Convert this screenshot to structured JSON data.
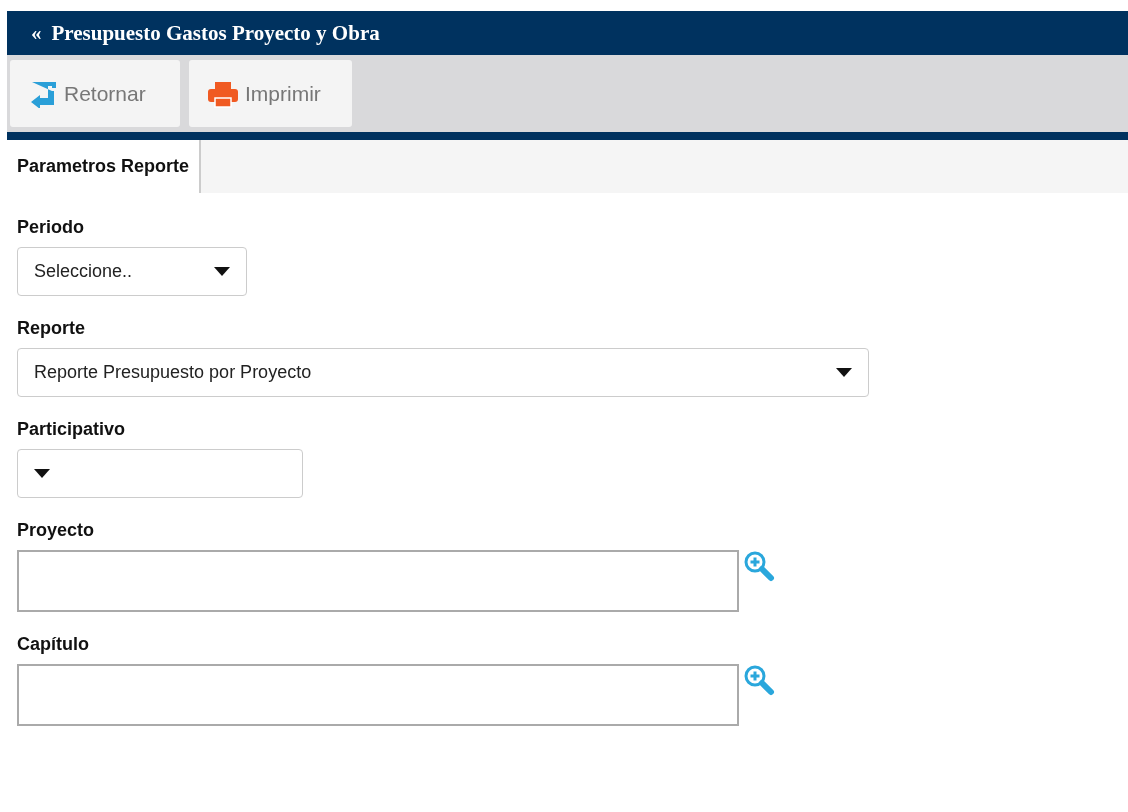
{
  "window": {
    "title": "Presupuesto Gastos Proyecto y Obra",
    "back_glyph": "«"
  },
  "toolbar": [
    {
      "kind": "return",
      "label": "Retornar"
    },
    {
      "kind": "print",
      "label": "Imprimir"
    }
  ],
  "tabs": [
    {
      "label": "Parametros Reporte",
      "selected": true
    }
  ],
  "fields": [
    {
      "kind": "select",
      "label": "Periodo",
      "value": "Seleccione.."
    },
    {
      "kind": "select",
      "label": "Reporte",
      "value": "Reporte Presupuesto por Proyecto"
    },
    {
      "kind": "select",
      "label": "Participativo"
    },
    {
      "kind": "lookup",
      "label": "Proyecto"
    },
    {
      "kind": "lookup",
      "label": "Capítulo"
    }
  ]
}
